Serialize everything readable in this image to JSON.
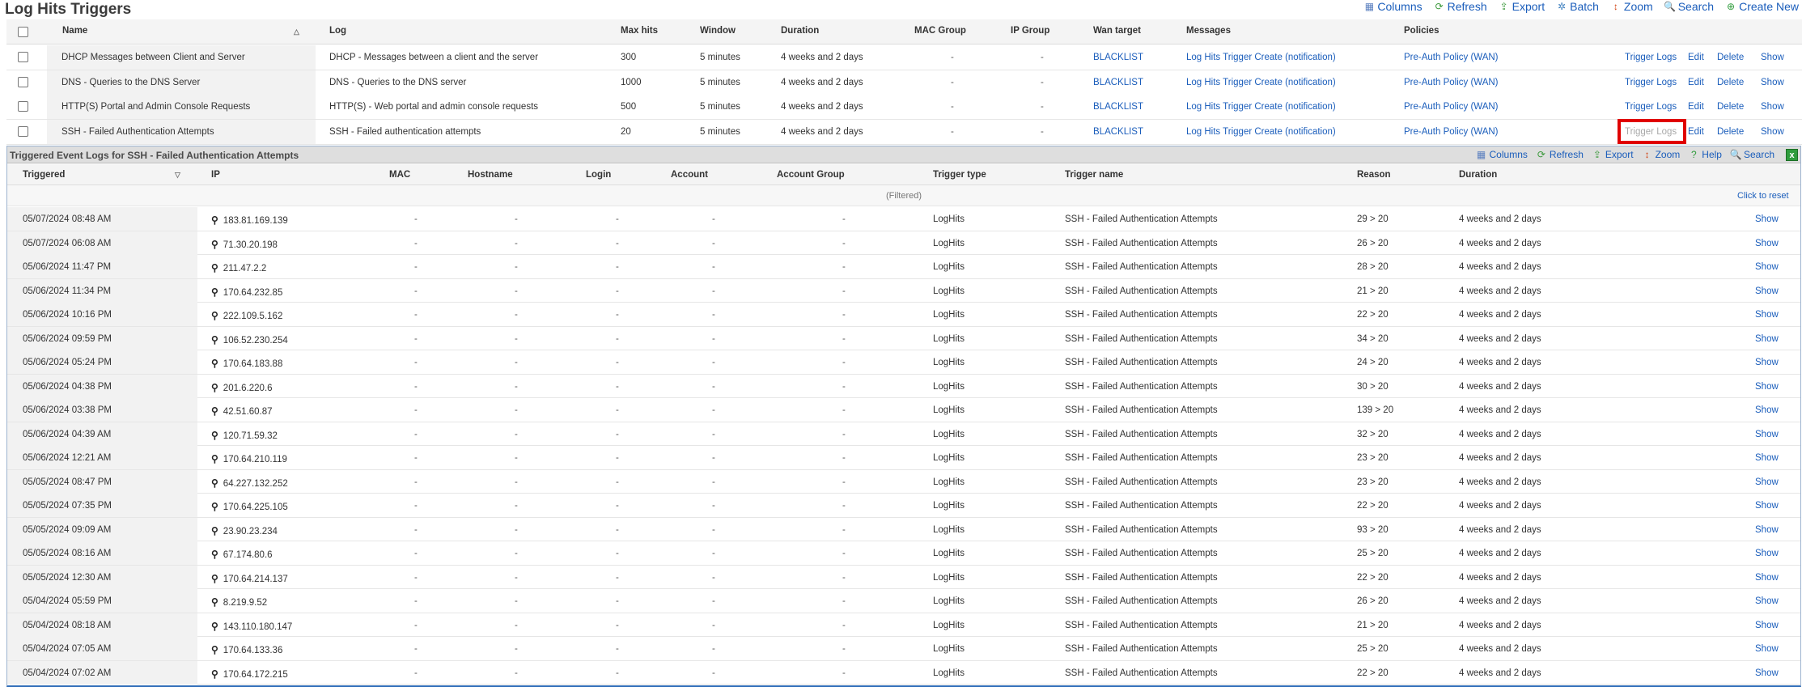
{
  "page": {
    "title": "Log Hits Triggers"
  },
  "toolbar": [
    {
      "label": "Columns",
      "icon": "columns-icon",
      "glyph": "▦",
      "color": "#5a7fbf"
    },
    {
      "label": "Refresh",
      "icon": "refresh-icon",
      "glyph": "⟳",
      "color": "#3d9a3d"
    },
    {
      "label": "Export",
      "icon": "export-icon",
      "glyph": "⇪",
      "color": "#3d9a3d"
    },
    {
      "label": "Batch",
      "icon": "batch-icon",
      "glyph": "✲",
      "color": "#3d7fbf"
    },
    {
      "label": "Zoom",
      "icon": "zoom-icon",
      "glyph": "↕",
      "color": "#d04010"
    },
    {
      "label": "Search",
      "icon": "search-icon",
      "glyph": "🔍",
      "color": "#3d7fbf"
    },
    {
      "label": "Create New",
      "icon": "create-new-icon",
      "glyph": "⊕",
      "color": "#2f9c3c"
    }
  ],
  "triggers_table": {
    "headers": {
      "name": "Name",
      "log": "Log",
      "max_hits": "Max hits",
      "window": "Window",
      "duration": "Duration",
      "mac_group": "MAC Group",
      "ip_group": "IP Group",
      "wan_target": "Wan target",
      "messages": "Messages",
      "policies": "Policies"
    },
    "rows": [
      {
        "name": "DHCP Messages between Client and Server",
        "log": "DHCP - Messages between a client and the server",
        "max_hits": "300",
        "window": "5 minutes",
        "duration": "4 weeks and 2 days",
        "mac_group": "-",
        "ip_group": "-",
        "wan_target": "BLACKLIST",
        "messages": "Log Hits Trigger Create (notification)",
        "policies": "Pre-Auth Policy (WAN)"
      },
      {
        "name": "DNS - Queries to the DNS Server",
        "log": "DNS - Queries to the DNS server",
        "max_hits": "1000",
        "window": "5 minutes",
        "duration": "4 weeks and 2 days",
        "mac_group": "-",
        "ip_group": "-",
        "wan_target": "BLACKLIST",
        "messages": "Log Hits Trigger Create (notification)",
        "policies": "Pre-Auth Policy (WAN)"
      },
      {
        "name": "HTTP(S) Portal and Admin Console Requests",
        "log": "HTTP(S) - Web portal and admin console requests",
        "max_hits": "500",
        "window": "5 minutes",
        "duration": "4 weeks and 2 days",
        "mac_group": "-",
        "ip_group": "-",
        "wan_target": "BLACKLIST",
        "messages": "Log Hits Trigger Create (notification)",
        "policies": "Pre-Auth Policy (WAN)"
      },
      {
        "name": "SSH - Failed Authentication Attempts",
        "log": "SSH - Failed authentication attempts",
        "max_hits": "20",
        "window": "5 minutes",
        "duration": "4 weeks and 2 days",
        "mac_group": "-",
        "ip_group": "-",
        "wan_target": "BLACKLIST",
        "messages": "Log Hits Trigger Create (notification)",
        "policies": "Pre-Auth Policy (WAN)"
      }
    ],
    "actions": {
      "trigger_logs": "Trigger Logs",
      "edit": "Edit",
      "delete": "Delete",
      "show": "Show"
    }
  },
  "sub_panel": {
    "title": "Triggered Event Logs for SSH - Failed Authentication Attempts",
    "toolbar": [
      {
        "label": "Columns",
        "icon": "columns-icon",
        "glyph": "▦",
        "color": "#5a7fbf"
      },
      {
        "label": "Refresh",
        "icon": "refresh-icon",
        "glyph": "⟳",
        "color": "#3d9a3d"
      },
      {
        "label": "Export",
        "icon": "export-icon",
        "glyph": "⇪",
        "color": "#3d9a3d"
      },
      {
        "label": "Zoom",
        "icon": "zoom-icon",
        "glyph": "↕",
        "color": "#d04010"
      },
      {
        "label": "Help",
        "icon": "help-icon",
        "glyph": "?",
        "color": "#2f9c3c"
      },
      {
        "label": "Search",
        "icon": "search-icon",
        "glyph": "🔍",
        "color": "#3d7fbf"
      }
    ],
    "close_glyph": "x",
    "headers": {
      "triggered": "Triggered",
      "ip": "IP",
      "mac": "MAC",
      "hostname": "Hostname",
      "login": "Login",
      "account": "Account",
      "account_group": "Account Group",
      "trigger_type": "Trigger type",
      "trigger_name": "Trigger name",
      "reason": "Reason",
      "duration": "Duration"
    },
    "filtered_label": "(Filtered)",
    "reset_label": "Click to reset",
    "show_label": "Show",
    "rows": [
      {
        "triggered": "05/07/2024 08:48 AM",
        "ip": "183.81.169.139",
        "reason": "29 > 20"
      },
      {
        "triggered": "05/07/2024 06:08 AM",
        "ip": "71.30.20.198",
        "reason": "26 > 20"
      },
      {
        "triggered": "05/06/2024 11:47 PM",
        "ip": "211.47.2.2",
        "reason": "28 > 20"
      },
      {
        "triggered": "05/06/2024 11:34 PM",
        "ip": "170.64.232.85",
        "reason": "21 > 20"
      },
      {
        "triggered": "05/06/2024 10:16 PM",
        "ip": "222.109.5.162",
        "reason": "22 > 20"
      },
      {
        "triggered": "05/06/2024 09:59 PM",
        "ip": "106.52.230.254",
        "reason": "34 > 20"
      },
      {
        "triggered": "05/06/2024 05:24 PM",
        "ip": "170.64.183.88",
        "reason": "24 > 20"
      },
      {
        "triggered": "05/06/2024 04:38 PM",
        "ip": "201.6.220.6",
        "reason": "30 > 20"
      },
      {
        "triggered": "05/06/2024 03:38 PM",
        "ip": "42.51.60.87",
        "reason": "139 > 20"
      },
      {
        "triggered": "05/06/2024 04:39 AM",
        "ip": "120.71.59.32",
        "reason": "32 > 20"
      },
      {
        "triggered": "05/06/2024 12:21 AM",
        "ip": "170.64.210.119",
        "reason": "23 > 20"
      },
      {
        "triggered": "05/05/2024 08:47 PM",
        "ip": "64.227.132.252",
        "reason": "23 > 20"
      },
      {
        "triggered": "05/05/2024 07:35 PM",
        "ip": "170.64.225.105",
        "reason": "22 > 20"
      },
      {
        "triggered": "05/05/2024 09:09 AM",
        "ip": "23.90.23.234",
        "reason": "93 > 20"
      },
      {
        "triggered": "05/05/2024 08:16 AM",
        "ip": "67.174.80.6",
        "reason": "25 > 20"
      },
      {
        "triggered": "05/05/2024 12:30 AM",
        "ip": "170.64.214.137",
        "reason": "22 > 20"
      },
      {
        "triggered": "05/04/2024 05:59 PM",
        "ip": "8.219.9.52",
        "reason": "26 > 20"
      },
      {
        "triggered": "05/04/2024 08:18 AM",
        "ip": "143.110.180.147",
        "reason": "21 > 20"
      },
      {
        "triggered": "05/04/2024 07:05 AM",
        "ip": "170.64.133.36",
        "reason": "25 > 20"
      },
      {
        "triggered": "05/04/2024 07:02 AM",
        "ip": "170.64.172.215",
        "reason": "22 > 20"
      }
    ],
    "common": {
      "dash": "-",
      "trigger_type": "LogHits",
      "trigger_name": "SSH - Failed Authentication Attempts",
      "duration": "4 weeks and 2 days"
    }
  }
}
